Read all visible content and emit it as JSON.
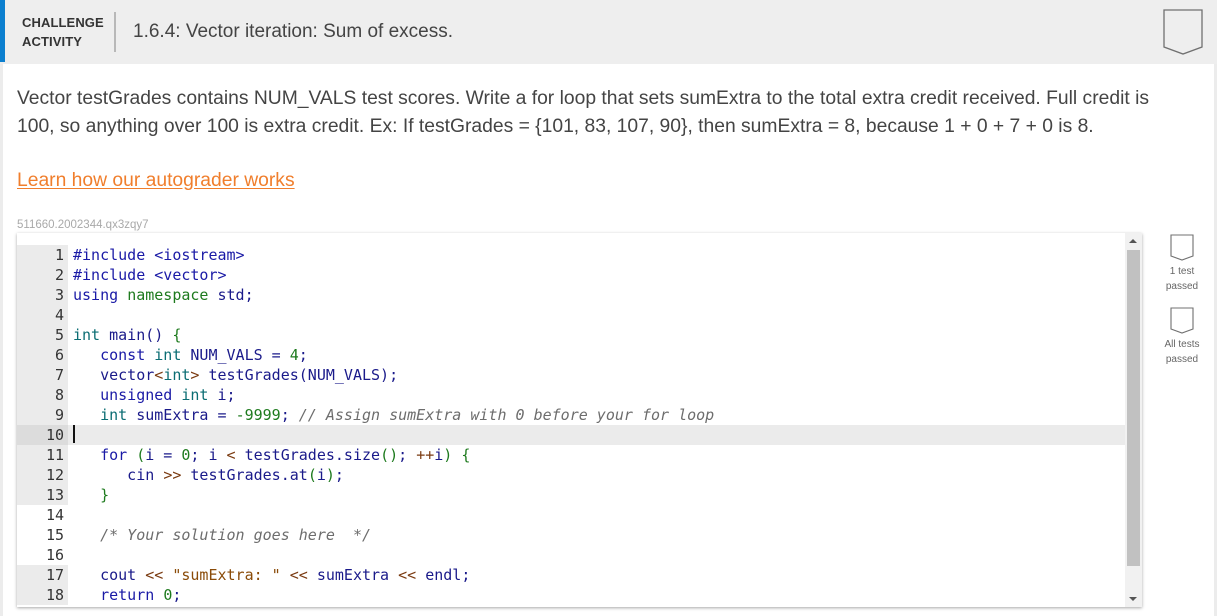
{
  "header": {
    "activity_type_line1": "CHALLENGE",
    "activity_type_line2": "ACTIVITY",
    "title": "1.6.4: Vector iteration: Sum of excess.",
    "completion_icon": "badge-outline-icon",
    "accent_color": "#0b7fcf"
  },
  "prompt": {
    "text": "Vector testGrades contains NUM_VALS test scores. Write a for loop that sets sumExtra to the total extra credit received. Full credit is 100, so anything over 100 is extra credit. Ex: If testGrades = {101, 83, 107, 90}, then sumExtra = 8, because 1 + 0 + 7 + 0 is 8."
  },
  "learn_link": {
    "label": "Learn how our autograder works",
    "color": "#f07e2c"
  },
  "activity_id": "511660.2002344.qx3zqy7",
  "editor": {
    "active_line": 10,
    "lines": [
      {
        "n": "1",
        "tokens": [
          [
            "kw",
            "#include "
          ],
          [
            "kw",
            "<iostream>"
          ]
        ]
      },
      {
        "n": "2",
        "tokens": [
          [
            "kw",
            "#include "
          ],
          [
            "kw",
            "<vector>"
          ]
        ]
      },
      {
        "n": "3",
        "tokens": [
          [
            "kw",
            "using "
          ],
          [
            "ns",
            "namespace"
          ],
          [
            "plain",
            " std;"
          ]
        ]
      },
      {
        "n": "4",
        "tokens": []
      },
      {
        "n": "5",
        "tokens": [
          [
            "type",
            "int"
          ],
          [
            "plain",
            " main() "
          ],
          [
            "br",
            "{"
          ]
        ]
      },
      {
        "n": "6",
        "tokens": [
          [
            "kw",
            "   const "
          ],
          [
            "type",
            "int"
          ],
          [
            "plain",
            " NUM_VALS = "
          ],
          [
            "num",
            "4"
          ],
          [
            "plain",
            ";"
          ]
        ]
      },
      {
        "n": "7",
        "tokens": [
          [
            "plain",
            "   vector"
          ],
          [
            "op",
            "<"
          ],
          [
            "type",
            "int"
          ],
          [
            "op",
            ">"
          ],
          [
            "plain",
            " testGrades(NUM_VALS);"
          ]
        ]
      },
      {
        "n": "8",
        "tokens": [
          [
            "kw",
            "   unsigned "
          ],
          [
            "type",
            "int"
          ],
          [
            "plain",
            " i;"
          ]
        ]
      },
      {
        "n": "9",
        "tokens": [
          [
            "type",
            "   int"
          ],
          [
            "plain",
            " sumExtra = "
          ],
          [
            "num",
            "-9999"
          ],
          [
            "plain",
            "; "
          ],
          [
            "com",
            "// Assign sumExtra with 0 before your for loop"
          ]
        ]
      },
      {
        "n": "10",
        "tokens": []
      },
      {
        "n": "11",
        "tokens": [
          [
            "kw",
            "   for "
          ],
          [
            "br",
            "("
          ],
          [
            "plain",
            "i = "
          ],
          [
            "num",
            "0"
          ],
          [
            "plain",
            "; i "
          ],
          [
            "op",
            "<"
          ],
          [
            "plain",
            " testGrades.size"
          ],
          [
            "br",
            "()"
          ],
          [
            "plain",
            "; "
          ],
          [
            "op",
            "++"
          ],
          [
            "plain",
            "i"
          ],
          [
            "br",
            ")"
          ],
          [
            "plain",
            " "
          ],
          [
            "br",
            "{"
          ]
        ]
      },
      {
        "n": "12",
        "tokens": [
          [
            "plain",
            "      cin "
          ],
          [
            "op",
            ">>"
          ],
          [
            "plain",
            " testGrades.at"
          ],
          [
            "br",
            "("
          ],
          [
            "plain",
            "i"
          ],
          [
            "br",
            ")"
          ],
          [
            "plain",
            ";"
          ]
        ]
      },
      {
        "n": "13",
        "tokens": [
          [
            "br",
            "   }"
          ]
        ]
      },
      {
        "n": "14",
        "tokens": []
      },
      {
        "n": "15",
        "tokens": [
          [
            "com",
            "   /* Your solution goes here  */"
          ]
        ]
      },
      {
        "n": "16",
        "tokens": []
      },
      {
        "n": "17",
        "tokens": [
          [
            "plain",
            "   cout "
          ],
          [
            "op",
            "<<"
          ],
          [
            "plain",
            " "
          ],
          [
            "str",
            "\"sumExtra: \""
          ],
          [
            "plain",
            " "
          ],
          [
            "op",
            "<<"
          ],
          [
            "plain",
            " sumExtra "
          ],
          [
            "op",
            "<<"
          ],
          [
            "plain",
            " endl;"
          ]
        ]
      },
      {
        "n": "18",
        "tokens": [
          [
            "kw",
            "   return "
          ],
          [
            "num",
            "0"
          ],
          [
            "plain",
            ";"
          ]
        ]
      }
    ],
    "no_gutter_lines": [
      "14",
      "15",
      "16"
    ]
  },
  "test_status": [
    {
      "label_line1": "1 test",
      "label_line2": "passed",
      "icon": "badge-outline-icon"
    },
    {
      "label_line1": "All tests",
      "label_line2": "passed",
      "icon": "badge-outline-icon"
    }
  ]
}
